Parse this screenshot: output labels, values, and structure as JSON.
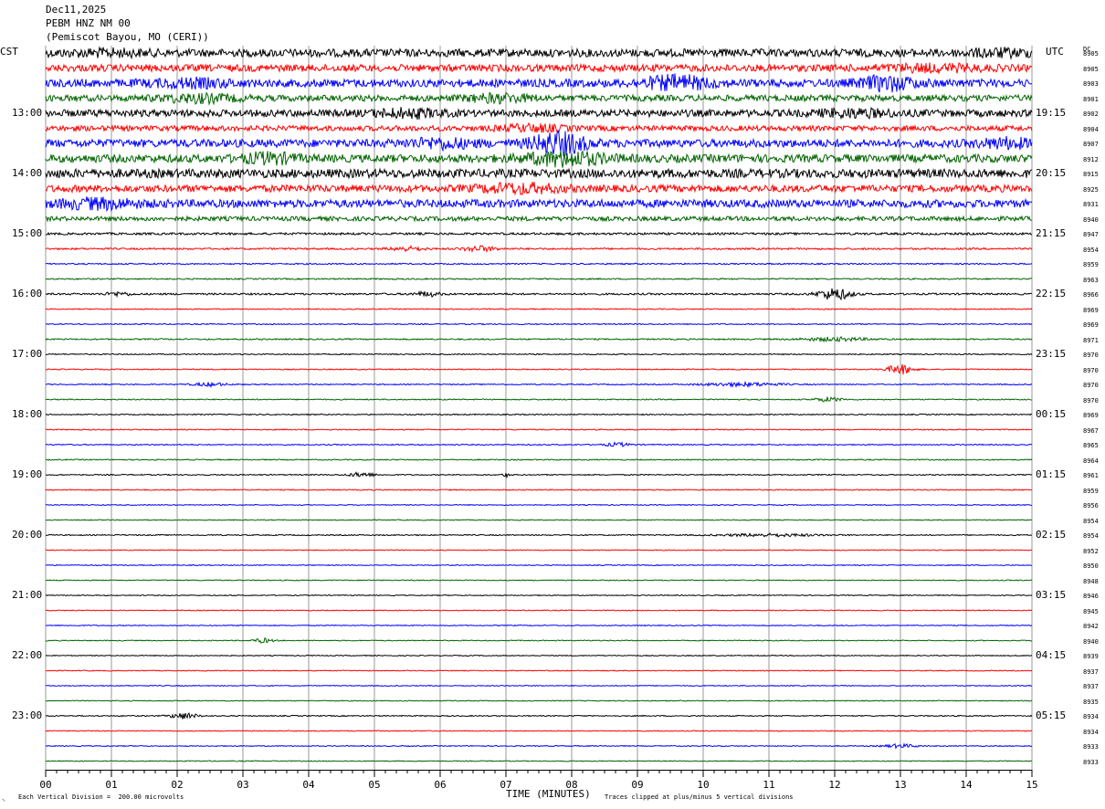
{
  "header": {
    "date": "Dec11,2025",
    "station": "PEBM HNZ NM 00",
    "location": "(Pemiscot Bayou, MO (CERI))"
  },
  "left_tz": "CST",
  "right_tz": "UTC",
  "dc_label": "DC",
  "left_hours": [
    "13:00",
    "14:00",
    "15:00",
    "16:00",
    "17:00",
    "18:00",
    "19:00",
    "20:00",
    "21:00",
    "22:00",
    "23:00"
  ],
  "right_hours": [
    "19:15",
    "20:15",
    "21:15",
    "22:15",
    "23:15",
    "00:15",
    "01:15",
    "02:15",
    "03:15",
    "04:15",
    "05:15"
  ],
  "dc_values": [
    "8905",
    "8905",
    "8903",
    "8901",
    "8902",
    "8904",
    "8907",
    "8912",
    "8915",
    "8925",
    "8931",
    "8940",
    "8947",
    "8954",
    "8959",
    "8963",
    "8966",
    "8969",
    "8969",
    "8971",
    "8970",
    "8970",
    "8970",
    "8970",
    "8969",
    "8967",
    "8965",
    "8964",
    "8961",
    "8959",
    "8956",
    "8954",
    "8954",
    "8952",
    "8950",
    "8948",
    "8946",
    "8945",
    "8942",
    "8940",
    "8939",
    "8937",
    "8937",
    "8935",
    "8934",
    "8934",
    "8933",
    "8933"
  ],
  "footer": {
    "mark": "⸜",
    "vertical_division": "Each Vertical Division =  200.00 microvolts",
    "xlabel": "TIME (MINUTES)",
    "clip_note": "Traces clipped at plus/minus 5 vertical divisions"
  },
  "colors": [
    "#000000",
    "#ff0000",
    "#0000ff",
    "#006400"
  ],
  "chart_data": {
    "type": "line",
    "title": "PEBM HNZ NM 00",
    "xlabel": "TIME (MINUTES)",
    "ylabel": "",
    "xlim": [
      0,
      15
    ],
    "x_ticks": [
      "00",
      "01",
      "02",
      "03",
      "04",
      "05",
      "06",
      "07",
      "08",
      "09",
      "10",
      "11",
      "12",
      "13",
      "14",
      "15"
    ],
    "trace_count": 48,
    "trace_interval_minutes": 15,
    "grid": "vertical lines every minute",
    "trace_amplitudes_divisions": [
      0.9,
      0.8,
      0.9,
      0.7,
      0.8,
      0.6,
      0.9,
      0.9,
      1.0,
      0.8,
      0.9,
      0.5,
      0.25,
      0.2,
      0.15,
      0.15,
      0.2,
      0.12,
      0.12,
      0.15,
      0.12,
      0.12,
      0.12,
      0.12,
      0.12,
      0.12,
      0.12,
      0.12,
      0.12,
      0.12,
      0.1,
      0.1,
      0.12,
      0.1,
      0.1,
      0.1,
      0.1,
      0.1,
      0.1,
      0.1,
      0.1,
      0.1,
      0.1,
      0.1,
      0.12,
      0.1,
      0.1,
      0.1
    ],
    "events": [
      {
        "trace": 0,
        "minute": 0.9,
        "amplitude": 0.4,
        "duration": 1.2
      },
      {
        "trace": 0,
        "minute": 14.5,
        "amplitude": 0.5,
        "duration": 1.0
      },
      {
        "trace": 1,
        "minute": 13.5,
        "amplitude": 0.5,
        "duration": 1.5
      },
      {
        "trace": 2,
        "minute": 9.6,
        "amplitude": 1.3,
        "duration": 1.0
      },
      {
        "trace": 2,
        "minute": 12.8,
        "amplitude": 1.3,
        "duration": 0.8
      },
      {
        "trace": 2,
        "minute": 2.2,
        "amplitude": 0.6,
        "duration": 1.2
      },
      {
        "trace": 3,
        "minute": 2.3,
        "amplitude": 0.7,
        "duration": 1.2
      },
      {
        "trace": 3,
        "minute": 6.9,
        "amplitude": 0.7,
        "duration": 1.0
      },
      {
        "trace": 4,
        "minute": 5.5,
        "amplitude": 0.7,
        "duration": 1.0
      },
      {
        "trace": 4,
        "minute": 12.3,
        "amplitude": 0.6,
        "duration": 1.2
      },
      {
        "trace": 5,
        "minute": 7.4,
        "amplitude": 0.6,
        "duration": 1.0
      },
      {
        "trace": 6,
        "minute": 7.8,
        "amplitude": 2.2,
        "duration": 0.8
      },
      {
        "trace": 6,
        "minute": 6.0,
        "amplitude": 0.8,
        "duration": 1.0
      },
      {
        "trace": 6,
        "minute": 14.6,
        "amplitude": 0.8,
        "duration": 0.8
      },
      {
        "trace": 7,
        "minute": 7.9,
        "amplitude": 1.3,
        "duration": 1.2
      },
      {
        "trace": 7,
        "minute": 3.4,
        "amplitude": 0.9,
        "duration": 0.8
      },
      {
        "trace": 9,
        "minute": 7.2,
        "amplitude": 0.8,
        "duration": 1.2
      },
      {
        "trace": 10,
        "minute": 0.8,
        "amplitude": 0.8,
        "duration": 1.2
      },
      {
        "trace": 13,
        "minute": 5.5,
        "amplitude": 0.5,
        "duration": 0.5
      },
      {
        "trace": 13,
        "minute": 6.6,
        "amplitude": 0.6,
        "duration": 0.5
      },
      {
        "trace": 16,
        "minute": 12.0,
        "amplitude": 1.3,
        "duration": 0.5
      },
      {
        "trace": 16,
        "minute": 5.8,
        "amplitude": 0.5,
        "duration": 0.4
      },
      {
        "trace": 16,
        "minute": 1.1,
        "amplitude": 0.4,
        "duration": 0.4
      },
      {
        "trace": 19,
        "minute": 12.0,
        "amplitude": 0.4,
        "duration": 1.0
      },
      {
        "trace": 21,
        "minute": 13.0,
        "amplitude": 1.1,
        "duration": 0.4
      },
      {
        "trace": 22,
        "minute": 2.5,
        "amplitude": 0.4,
        "duration": 0.5
      },
      {
        "trace": 22,
        "minute": 10.6,
        "amplitude": 0.4,
        "duration": 1.2
      },
      {
        "trace": 23,
        "minute": 11.9,
        "amplitude": 0.5,
        "duration": 0.4
      },
      {
        "trace": 26,
        "minute": 8.7,
        "amplitude": 0.4,
        "duration": 0.4
      },
      {
        "trace": 28,
        "minute": 4.8,
        "amplitude": 0.5,
        "duration": 0.4
      },
      {
        "trace": 28,
        "minute": 7.0,
        "amplitude": 0.5,
        "duration": 0.1
      },
      {
        "trace": 32,
        "minute": 11.0,
        "amplitude": 0.3,
        "duration": 1.5
      },
      {
        "trace": 39,
        "minute": 3.3,
        "amplitude": 0.5,
        "duration": 0.3
      },
      {
        "trace": 44,
        "minute": 2.1,
        "amplitude": 0.7,
        "duration": 0.4
      },
      {
        "trace": 46,
        "minute": 13.0,
        "amplitude": 0.4,
        "duration": 0.5
      }
    ]
  }
}
